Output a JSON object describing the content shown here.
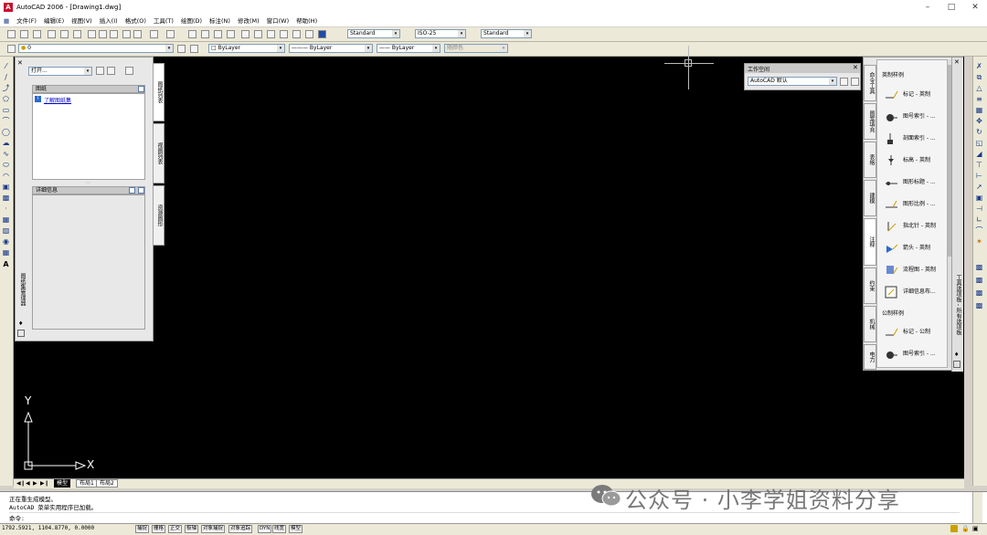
{
  "window": {
    "title": "AutoCAD 2006 - [Drawing1.dwg]",
    "app_icon_glyph": "A"
  },
  "menu": [
    "文件(F)",
    "编辑(E)",
    "视图(V)",
    "插入(I)",
    "格式(O)",
    "工具(T)",
    "绘图(D)",
    "标注(N)",
    "修改(M)",
    "窗口(W)",
    "帮助(H)"
  ],
  "toolbar": {
    "text_style": "Standard",
    "dim_style": "ISO-25",
    "table_style": "Standard",
    "layer": "0",
    "color": "ByLayer",
    "linetype": "ByLayer",
    "lineweight": "ByLayer",
    "plot_style": "随颜色"
  },
  "sheet_set": {
    "open_combo": "打开...",
    "sheets_header": "图纸",
    "sheets_link": "了解图纸集",
    "details_header": "详细信息",
    "tabs": [
      "图纸列表",
      "视图列表",
      "资源图形"
    ],
    "title_vertical": "图纸集管理器"
  },
  "workspace": {
    "title": "工作空间",
    "value": "AutoCAD 默认"
  },
  "tool_palette": {
    "title_vertical": "工具选项板 - 所有选项板",
    "tabs": [
      "命令工具",
      "图案填充",
      "表格",
      "建模",
      "注释",
      "约束",
      "机械",
      "电力",
      "土木工程",
      "结构"
    ],
    "section_imperial": "英制样例",
    "section_metric": "公制样例",
    "items": [
      "标记 - 英制",
      "图号索引 - ...",
      "剖面索引 - ...",
      "标高 - 英制",
      "图形标题 - ...",
      "图形比例 - ...",
      "指北针 - 英制",
      "箭头 - 英制",
      "流程图 - 英制",
      "详细信息布...",
      "标记 - 公制",
      "图号索引 - ..."
    ]
  },
  "axis": {
    "x_label": "X",
    "y_label": "Y"
  },
  "layout_tabs": [
    "模型",
    "布局1",
    "布局2"
  ],
  "command": {
    "lines": [
      "正在重生成模型。",
      "AutoCAD 菜单实用程序已加载。"
    ],
    "prompt": "命令:"
  },
  "status": {
    "coords": "1792.5921, 1104.8770, 0.0000",
    "buttons": [
      "捕捉",
      "栅格",
      "正交",
      "极轴",
      "对象捕捉",
      "对象追踪",
      "DYN",
      "线宽",
      "模型"
    ]
  },
  "watermark": "公众号 · 小李学姐资料分享"
}
